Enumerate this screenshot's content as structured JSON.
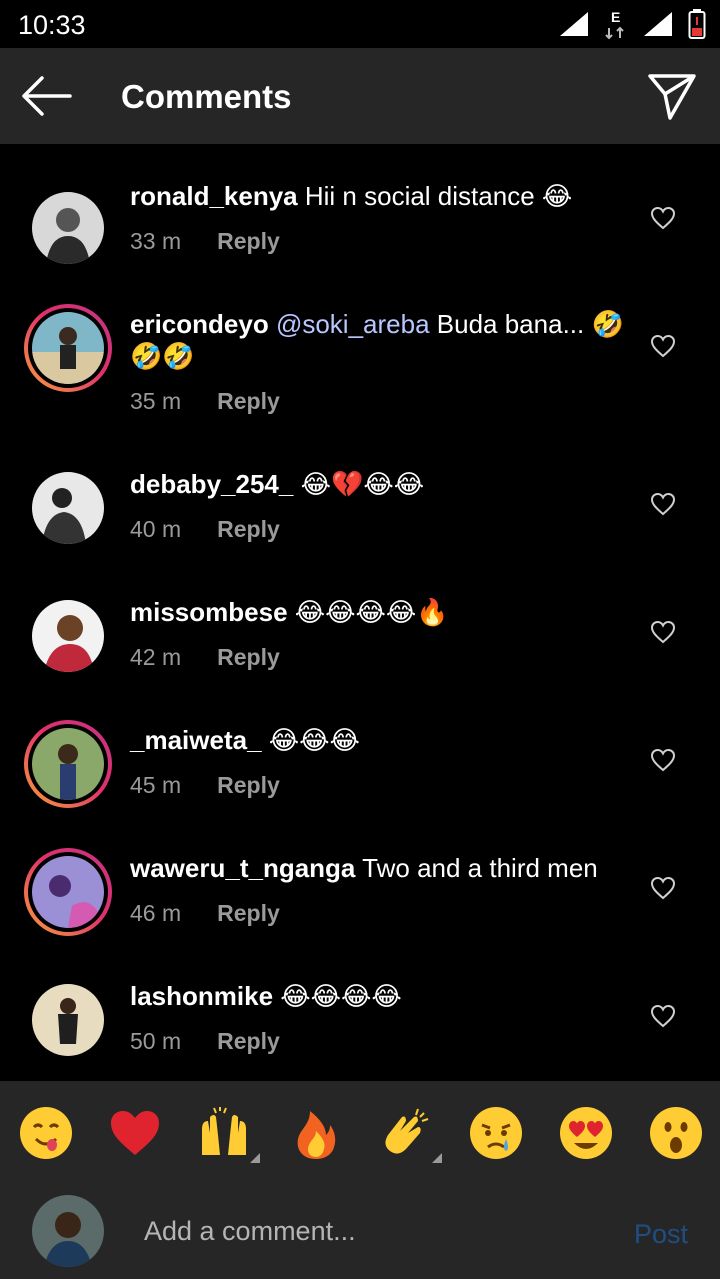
{
  "status_bar": {
    "time": "10:33",
    "network_label": "E"
  },
  "header": {
    "title": "Comments",
    "back_icon": "arrow-left-icon",
    "send_icon": "paper-plane-icon"
  },
  "comments": [
    {
      "username": "ronald_kenya",
      "text": "Hii n social distance 😂",
      "mention": "",
      "time": "33 m",
      "reply": "Reply",
      "story_ring": false
    },
    {
      "username": "ericondeyo",
      "mention": "@soki_areba",
      "text": "Buda bana... 🤣🤣🤣",
      "time": "35 m",
      "reply": "Reply",
      "story_ring": true
    },
    {
      "username": "debaby_254_",
      "text": "😂💔😂😂",
      "mention": "",
      "time": "40 m",
      "reply": "Reply",
      "story_ring": false
    },
    {
      "username": "missombese",
      "text": "😂😂😂😂🔥",
      "mention": "",
      "time": "42 m",
      "reply": "Reply",
      "story_ring": false
    },
    {
      "username": "_maiweta_",
      "text": "😂😂😂",
      "mention": "",
      "time": "45 m",
      "reply": "Reply",
      "story_ring": true
    },
    {
      "username": "waweru_t_nganga",
      "text": "Two and a third men",
      "mention": "",
      "time": "46 m",
      "reply": "Reply",
      "story_ring": true
    },
    {
      "username": "lashonmike",
      "text": "😂😂😂😂",
      "mention": "",
      "time": "50 m",
      "reply": "Reply",
      "story_ring": false
    }
  ],
  "quick_emojis": [
    "😋",
    "❤️",
    "🙌",
    "🔥",
    "👏",
    "😢",
    "😍",
    "😮"
  ],
  "composer": {
    "placeholder": "Add a comment...",
    "post_label": "Post"
  },
  "colors": {
    "background": "#000000",
    "bar": "#262626",
    "muted_text": "#9a9a9a",
    "post_disabled": "#1f4f82",
    "mention": "#b8c7ff"
  }
}
